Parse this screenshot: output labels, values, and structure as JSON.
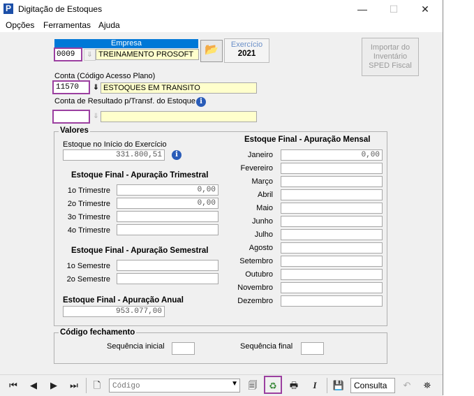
{
  "window": {
    "title": "Digitação de Estoques"
  },
  "window_controls": {
    "minimize": "—",
    "maximize": "☐",
    "close": "✕"
  },
  "menu": {
    "items": [
      "Opções",
      "Ferramentas",
      "Ajuda"
    ]
  },
  "empresa": {
    "label": "Empresa",
    "code": "0009",
    "name": "TREINAMENTO PROSOFT"
  },
  "exercicio": {
    "label": "Exercício",
    "value": "2021"
  },
  "import_button": {
    "label": "Importar do Inventário SPED Fiscal"
  },
  "conta": {
    "label": "Conta (Código Acesso Plano)",
    "code": "11570",
    "name": "ESTOQUES EM TRANSITO"
  },
  "conta_resultado": {
    "label": "Conta de Resultado p/Transf. do Estoque",
    "code": "",
    "name": ""
  },
  "valores": {
    "title": "Valores",
    "inicio_label": "Estoque no Início do Exercício",
    "inicio_value": "331.800,51",
    "trimestral": {
      "title": "Estoque Final - Apuração Trimestral",
      "rows": [
        {
          "label": "1o Trimestre",
          "value": "0,00"
        },
        {
          "label": "2o Trimestre",
          "value": "0,00"
        },
        {
          "label": "3o Trimestre",
          "value": ""
        },
        {
          "label": "4o Trimestre",
          "value": ""
        }
      ]
    },
    "semestral": {
      "title": "Estoque Final - Apuração Semestral",
      "rows": [
        {
          "label": "1o Semestre",
          "value": ""
        },
        {
          "label": "2o Semestre",
          "value": ""
        }
      ]
    },
    "anual": {
      "title": "Estoque Final - Apuração Anual",
      "value": "953.077,00"
    },
    "mensal": {
      "title": "Estoque Final - Apuração Mensal",
      "rows": [
        {
          "label": "Janeiro",
          "value": "0,00"
        },
        {
          "label": "Fevereiro",
          "value": ""
        },
        {
          "label": "Março",
          "value": ""
        },
        {
          "label": "Abril",
          "value": ""
        },
        {
          "label": "Maio",
          "value": ""
        },
        {
          "label": "Junho",
          "value": ""
        },
        {
          "label": "Julho",
          "value": ""
        },
        {
          "label": "Agosto",
          "value": ""
        },
        {
          "label": "Setembro",
          "value": ""
        },
        {
          "label": "Outubro",
          "value": ""
        },
        {
          "label": "Novembro",
          "value": ""
        },
        {
          "label": "Dezembro",
          "value": ""
        }
      ]
    }
  },
  "fechamento": {
    "title": "Código fechamento",
    "inicial_label": "Sequência inicial",
    "inicial_value": "",
    "final_label": "Sequência final",
    "final_value": ""
  },
  "toolbar": {
    "search_placeholder": "Código",
    "mode_label": "Consulta"
  },
  "colors": {
    "highlight": "#9b3fa0",
    "empresa_header": "#0078d7",
    "yellow_field": "#ffffcc"
  }
}
